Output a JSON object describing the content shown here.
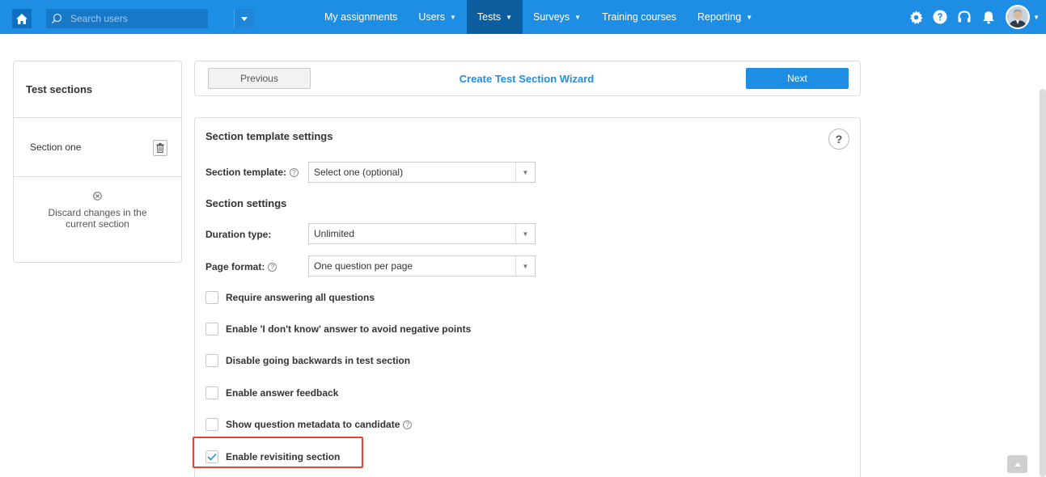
{
  "navbar": {
    "search_placeholder": "Search users",
    "items": [
      {
        "label": "My assignments",
        "has_caret": false,
        "active": false
      },
      {
        "label": "Users",
        "has_caret": true,
        "active": false
      },
      {
        "label": "Tests",
        "has_caret": true,
        "active": true
      },
      {
        "label": "Surveys",
        "has_caret": true,
        "active": false
      },
      {
        "label": "Training courses",
        "has_caret": false,
        "active": false
      },
      {
        "label": "Reporting",
        "has_caret": true,
        "active": false
      }
    ],
    "icons": [
      "gear-icon",
      "help-icon",
      "headset-icon",
      "bell-icon"
    ]
  },
  "left_panel": {
    "title": "Test sections",
    "section_name": "Section one",
    "discard_label": "Discard changes in the current section"
  },
  "wizard": {
    "previous_label": "Previous",
    "title": "Create Test Section Wizard",
    "next_label": "Next"
  },
  "settings": {
    "template_heading": "Section template settings",
    "template_label": "Section template:",
    "template_value": "Select one (optional)",
    "section_heading": "Section settings",
    "duration_label": "Duration type:",
    "duration_value": "Unlimited",
    "page_format_label": "Page format:",
    "page_format_value": "One question per page",
    "options": [
      {
        "label": "Require answering all questions",
        "checked": false,
        "has_help": false
      },
      {
        "label": "Enable 'I don't know' answer to avoid negative points",
        "checked": false,
        "has_help": false
      },
      {
        "label": "Disable going backwards in test section",
        "checked": false,
        "has_help": false
      },
      {
        "label": "Enable answer feedback",
        "checked": false,
        "has_help": false
      },
      {
        "label": "Show question metadata to candidate",
        "checked": false,
        "has_help": true
      },
      {
        "label": "Enable revisiting section",
        "checked": true,
        "has_help": false
      }
    ]
  },
  "colors": {
    "brand": "#1e8ee5",
    "active_nav": "#0d5e9e",
    "highlight": "#e8413a"
  }
}
